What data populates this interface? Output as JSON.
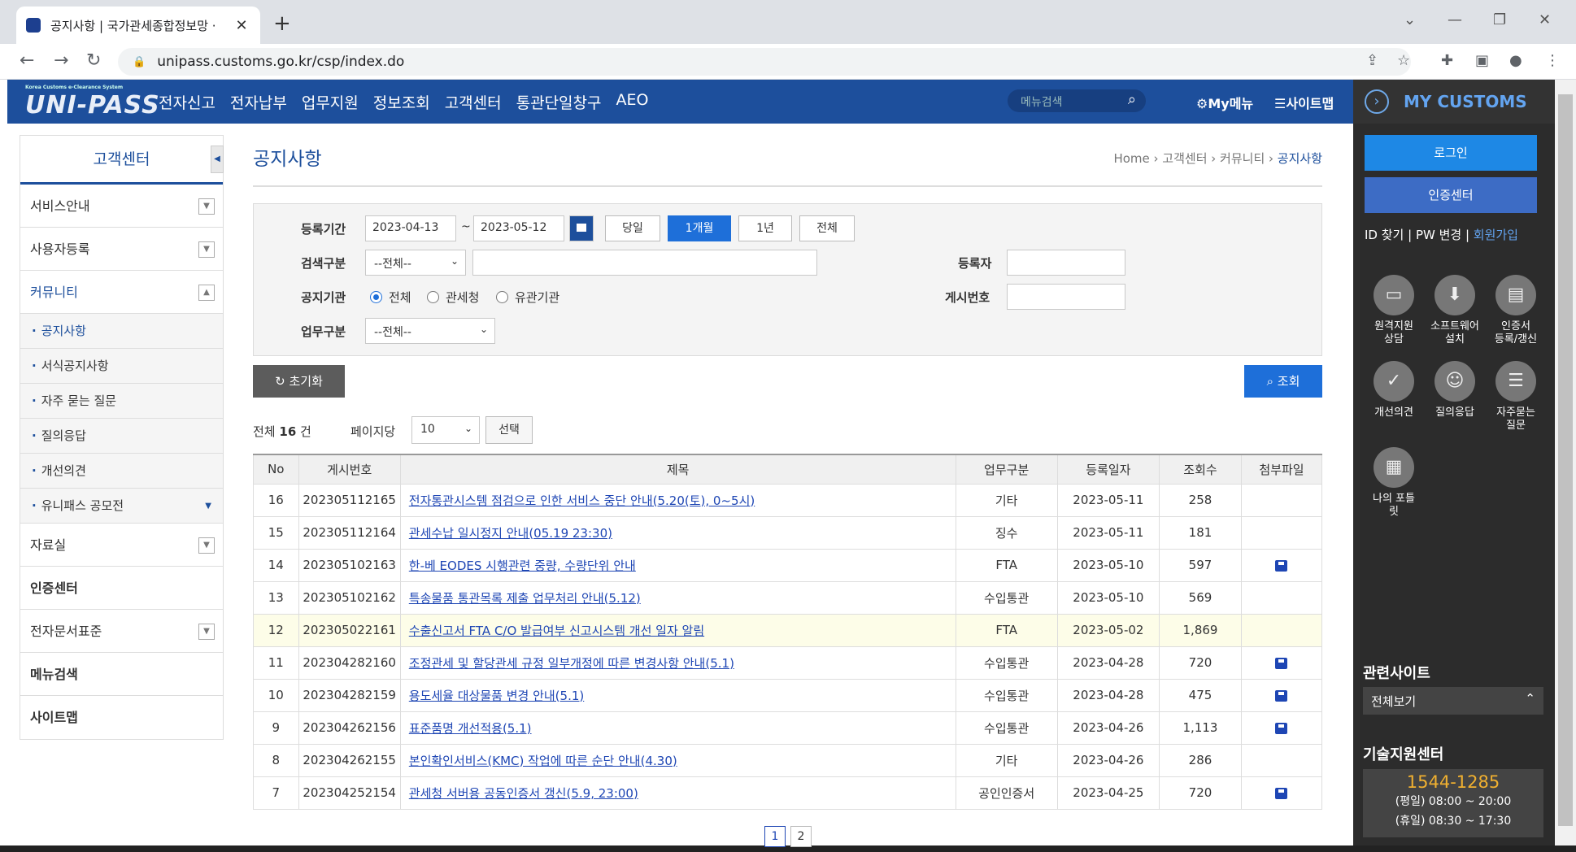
{
  "browser": {
    "tab_title": "공지사항 | 국가관세종합정보망 ·",
    "url": "unipass.customs.go.kr/csp/index.do"
  },
  "header": {
    "logo_small": "Korea Customs e-Clearance System",
    "logo": "UNI-PASS",
    "menu": [
      "전자신고",
      "전자납부",
      "업무지원",
      "정보조회",
      "고객센터",
      "통관단일창구",
      "AEO"
    ],
    "search_placeholder": "메뉴검색",
    "my_menu": "My메뉴",
    "sitemap": "사이트맵"
  },
  "right_panel": {
    "title": "MY CUSTOMS",
    "login": "로그인",
    "cert_center": "인증센터",
    "links": [
      "ID 찾기",
      "PW 변경",
      "회원가입"
    ],
    "shortcuts": [
      {
        "label": "원격지원\n상담",
        "icon": "remote-support-icon"
      },
      {
        "label": "소프트웨어\n설치",
        "icon": "software-install-icon"
      },
      {
        "label": "인증서\n등록/갱신",
        "icon": "certificate-icon"
      },
      {
        "label": "개선의견",
        "icon": "feedback-icon"
      },
      {
        "label": "질의응답",
        "icon": "qna-icon"
      },
      {
        "label": "자주묻는\n질문",
        "icon": "faq-icon"
      },
      {
        "label": "나의 포틀\n릿",
        "icon": "portlet-icon"
      }
    ],
    "related_title": "관련사이트",
    "related_select": "전체보기",
    "tech_title": "기술지원센터",
    "tech_phone": "1544-1285",
    "tech_hours_weekday": "(평일) 08:00 ~ 20:00",
    "tech_hours_holiday": "(휴일) 08:30 ~ 17:30"
  },
  "left_nav": {
    "title": "고객센터",
    "items": [
      {
        "label": "서비스안내",
        "toggle": true
      },
      {
        "label": "사용자등록",
        "toggle": true
      },
      {
        "label": "커뮤니티",
        "toggle": true,
        "open": true
      }
    ],
    "sub_items": [
      "공지사항",
      "서식공지사항",
      "자주 묻는 질문",
      "질의응답",
      "개선의견",
      "유니패스 공모전"
    ],
    "items_after": [
      {
        "label": "자료실",
        "toggle": true
      },
      {
        "label": "인증센터",
        "toggle": false
      },
      {
        "label": "전자문서표준",
        "toggle": true
      },
      {
        "label": "메뉴검색",
        "toggle": false
      },
      {
        "label": "사이트맵",
        "toggle": false
      }
    ]
  },
  "page": {
    "title": "공지사항",
    "breadcrumb": [
      "Home",
      "고객센터",
      "커뮤니티",
      "공지사항"
    ]
  },
  "filter": {
    "period_label": "등록기간",
    "date_from": "2023-04-13",
    "date_sep": "~",
    "date_to": "2023-05-12",
    "period_buttons": [
      "당일",
      "1개월",
      "1년",
      "전체"
    ],
    "period_selected": "1개월",
    "search_type_label": "검색구분",
    "search_type_value": "--전체--",
    "registrant_label": "등록자",
    "agency_label": "공지기관",
    "agency_options": [
      "전체",
      "관세청",
      "유관기관"
    ],
    "agency_selected": "전체",
    "post_no_label": "게시번호",
    "biz_type_label": "업무구분",
    "biz_type_value": "--전체--",
    "reset_label": "초기화",
    "search_label": "조회"
  },
  "list": {
    "total_prefix": "전체",
    "total_count": "16",
    "total_suffix": "건",
    "per_page_label": "페이지당",
    "per_page_value": "10",
    "select_label": "선택",
    "columns": [
      "No",
      "게시번호",
      "제목",
      "업무구분",
      "등록일자",
      "조회수",
      "첨부파일"
    ],
    "rows": [
      {
        "no": "16",
        "post": "202305112165",
        "title": "전자통관시스템 점검으로 인한 서비스 중단 안내(5.20(토), 0~5시)",
        "type": "기타",
        "date": "2023-05-11",
        "views": "258",
        "file": false
      },
      {
        "no": "15",
        "post": "202305112164",
        "title": "관세수납 일시정지 안내(05.19 23:30)",
        "type": "징수",
        "date": "2023-05-11",
        "views": "181",
        "file": false
      },
      {
        "no": "14",
        "post": "202305102163",
        "title": "한-베 EODES 시행관련 중량, 수량단위 안내",
        "type": "FTA",
        "date": "2023-05-10",
        "views": "597",
        "file": true
      },
      {
        "no": "13",
        "post": "202305102162",
        "title": "특송물품 통관목록 제출 업무처리 안내(5.12)",
        "type": "수입통관",
        "date": "2023-05-10",
        "views": "569",
        "file": false
      },
      {
        "no": "12",
        "post": "202305022161",
        "title": "수출신고서 FTA C/O 발급여부 신고시스템 개선 일자 알림",
        "type": "FTA",
        "date": "2023-05-02",
        "views": "1,869",
        "file": false
      },
      {
        "no": "11",
        "post": "202304282160",
        "title": "조정관세 및 할당관세 규정 일부개정에 따른 변경사항 안내(5.1)",
        "type": "수입통관",
        "date": "2023-04-28",
        "views": "720",
        "file": true
      },
      {
        "no": "10",
        "post": "202304282159",
        "title": "용도세율 대상물품 변경 안내(5.1)",
        "type": "수입통관",
        "date": "2023-04-28",
        "views": "475",
        "file": true
      },
      {
        "no": "9",
        "post": "202304262156",
        "title": "표준품명 개선적용(5.1)",
        "type": "수입통관",
        "date": "2023-04-26",
        "views": "1,113",
        "file": true
      },
      {
        "no": "8",
        "post": "202304262155",
        "title": "본인확인서비스(KMC) 작업에 따른 순단 안내(4.30)",
        "type": "기타",
        "date": "2023-04-26",
        "views": "286",
        "file": false
      },
      {
        "no": "7",
        "post": "202304252154",
        "title": "관세청 서버용 공동인증서 갱신(5.9, 23:00)",
        "type": "공인인증서",
        "date": "2023-04-25",
        "views": "720",
        "file": true
      }
    ],
    "pages": [
      "1",
      "2"
    ],
    "current_page": "1"
  }
}
